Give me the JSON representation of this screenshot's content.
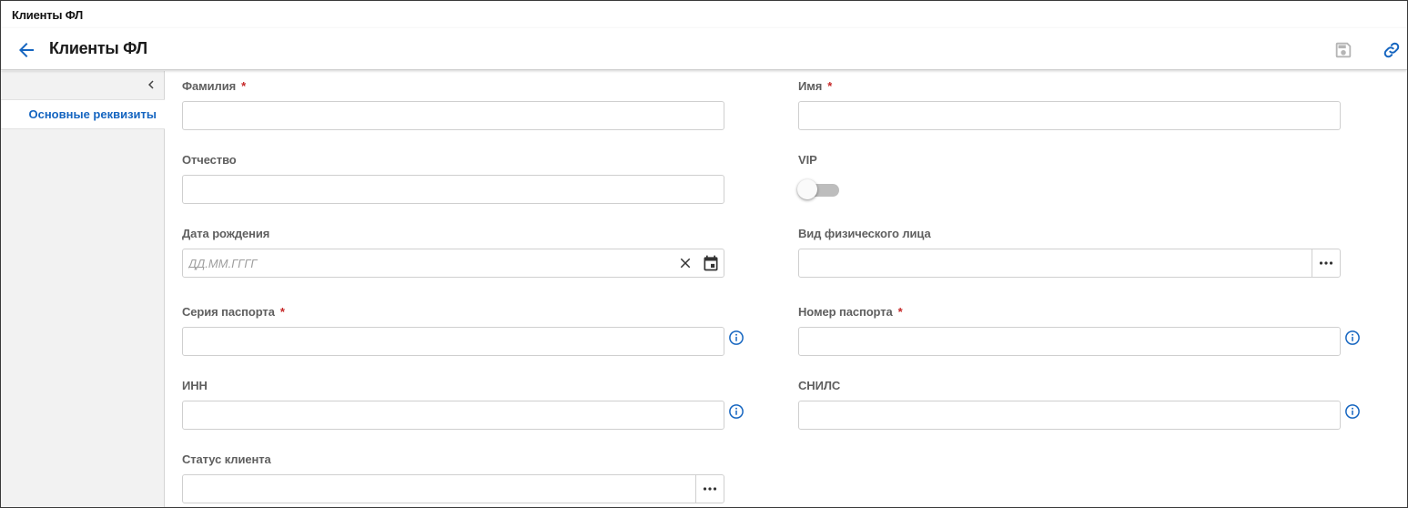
{
  "window": {
    "title": "Клиенты ФЛ"
  },
  "header": {
    "title": "Клиенты ФЛ"
  },
  "sidebar": {
    "items": [
      {
        "label": "Основные реквизиты"
      }
    ]
  },
  "form": {
    "required_mark": "*",
    "last_name": {
      "label": "Фамилия",
      "value": ""
    },
    "first_name": {
      "label": "Имя",
      "value": ""
    },
    "patronymic": {
      "label": "Отчество",
      "value": ""
    },
    "vip": {
      "label": "VIP",
      "checked": false
    },
    "birth_date": {
      "label": "Дата рождения",
      "placeholder": "ДД.ММ.ГГГГ",
      "value": ""
    },
    "person_type": {
      "label": "Вид физического лица",
      "value": ""
    },
    "passport_series": {
      "label": "Серия паспорта",
      "value": ""
    },
    "passport_number": {
      "label": "Номер паспорта",
      "value": ""
    },
    "inn": {
      "label": "ИНН",
      "value": ""
    },
    "snils": {
      "label": "СНИЛС",
      "value": ""
    },
    "client_status": {
      "label": "Статус клиента",
      "value": ""
    }
  },
  "colors": {
    "accent": "#1565c0",
    "required": "#c62828",
    "label": "#5f5f5f",
    "sidebar_bg": "#f2f2f2"
  },
  "icons": {
    "back": "arrow-left-icon",
    "save": "floppy-disk-icon",
    "link": "link-icon",
    "collapse": "chevron-left-icon",
    "clear": "close-icon",
    "calendar": "calendar-icon",
    "more": "more-horizontal-icon",
    "info": "info-icon"
  }
}
